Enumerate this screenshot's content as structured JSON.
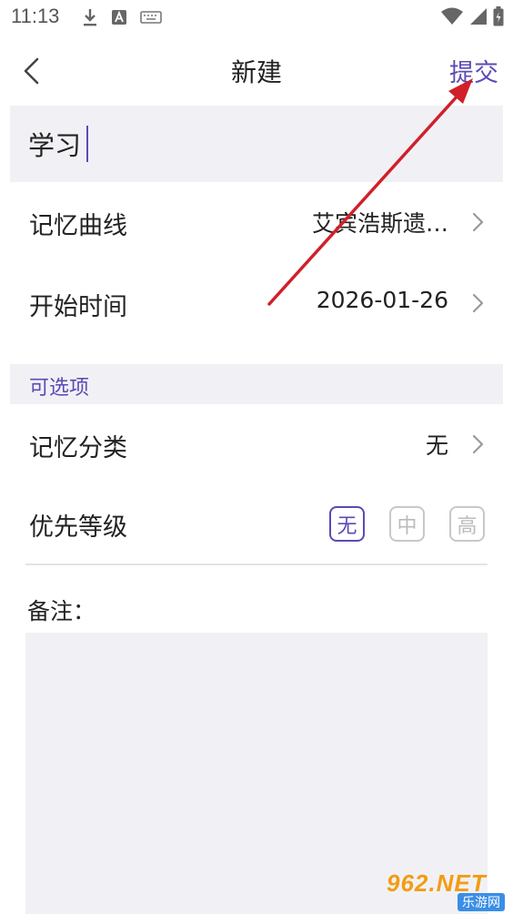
{
  "status_bar": {
    "time": "11:13",
    "left_icons": [
      "download-icon",
      "a-box-icon",
      "keyboard-icon"
    ],
    "right_icons": [
      "wifi-icon",
      "signal-icon",
      "battery-icon"
    ]
  },
  "nav": {
    "title": "新建",
    "submit_label": "提交"
  },
  "title_input": {
    "value": "学习"
  },
  "rows": {
    "memory_curve": {
      "label": "记忆曲线",
      "value": "艾宾浩斯遗…"
    },
    "start_time": {
      "label": "开始时间",
      "value": "2026-01-26"
    }
  },
  "optional_section": {
    "title": "可选项",
    "category": {
      "label": "记忆分类",
      "value": "无"
    },
    "priority": {
      "label": "优先等级",
      "options": [
        "无",
        "中",
        "高"
      ],
      "selected": "无"
    }
  },
  "notes": {
    "label": "备注：",
    "value": ""
  },
  "watermark": {
    "main": "962.NET",
    "sub": "乐游网"
  },
  "colors": {
    "accent": "#5a4bb5",
    "panel_bg": "#f1f1f5",
    "arrow": "#d0202a"
  }
}
